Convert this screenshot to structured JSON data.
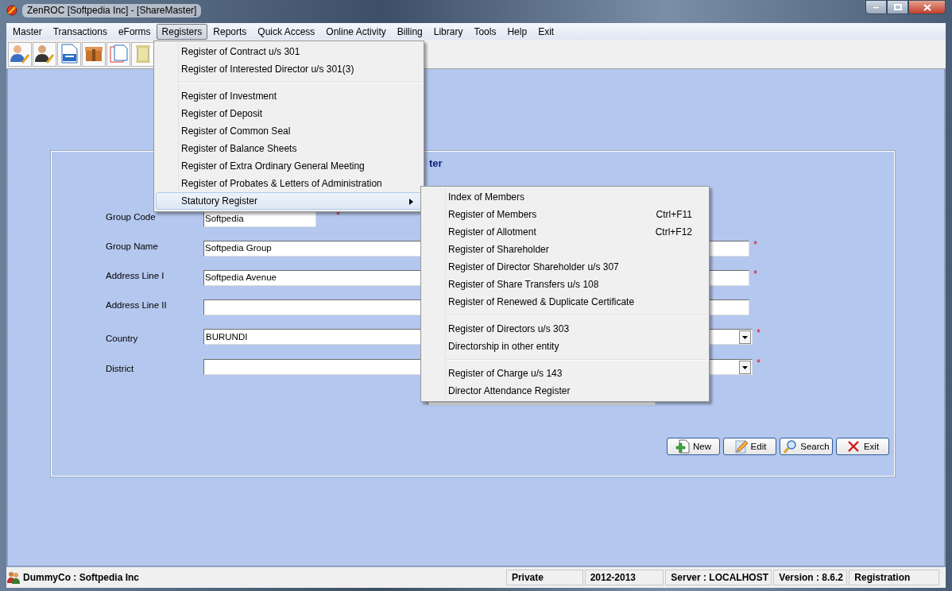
{
  "window": {
    "title": "ZenROC [Softpedia Inc] - [ShareMaster]"
  },
  "menu_bar": [
    {
      "label": "Master",
      "selected": false
    },
    {
      "label": "Transactions",
      "selected": false
    },
    {
      "label": "eForms",
      "selected": false
    },
    {
      "label": "Registers",
      "selected": true
    },
    {
      "label": "Reports",
      "selected": false
    },
    {
      "label": "Quick Access",
      "selected": false
    },
    {
      "label": "Online Activity",
      "selected": false
    },
    {
      "label": "Billing",
      "selected": false
    },
    {
      "label": "Library",
      "selected": false
    },
    {
      "label": "Tools",
      "selected": false
    },
    {
      "label": "Help",
      "selected": false
    },
    {
      "label": "Exit",
      "selected": false
    }
  ],
  "toolbar": [
    {
      "kind": "user-edit"
    },
    {
      "kind": "user-dark"
    },
    {
      "kind": "form"
    },
    {
      "kind": "box"
    },
    {
      "kind": "pages"
    },
    {
      "kind": "scroll"
    }
  ],
  "registers_menu": [
    {
      "kind": "item",
      "label": "Register of Contract u/s 301",
      "selected": false
    },
    {
      "kind": "item",
      "label": "Register of Interested Director u/s 301(3)",
      "selected": false
    },
    {
      "kind": "separator"
    },
    {
      "kind": "item",
      "label": "Register of Investment",
      "selected": false
    },
    {
      "kind": "item",
      "label": "Register of Deposit",
      "selected": false
    },
    {
      "kind": "item",
      "label": "Register of Common Seal",
      "selected": false
    },
    {
      "kind": "item",
      "label": "Register of Balance Sheets",
      "selected": false
    },
    {
      "kind": "item",
      "label": "Register of Extra Ordinary General Meeting",
      "selected": false
    },
    {
      "kind": "item",
      "label": "Register of Probates & Letters of Administration",
      "selected": false
    },
    {
      "kind": "submenu",
      "label": "Statutory Register",
      "selected": true
    }
  ],
  "statutory_submenu": [
    {
      "kind": "item",
      "label": "Index of Members",
      "selected": false
    },
    {
      "kind": "item",
      "label": "Register of Members",
      "shortcut": "Ctrl+F11",
      "selected": false
    },
    {
      "kind": "item",
      "label": "Register of Allotment",
      "shortcut": "Ctrl+F12",
      "selected": false
    },
    {
      "kind": "item",
      "label": "Register of Shareholder",
      "selected": false
    },
    {
      "kind": "item",
      "label": "Register of Director Shareholder u/s 307",
      "selected": false
    },
    {
      "kind": "item",
      "label": "Register of Share Transfers u/s 108",
      "selected": false
    },
    {
      "kind": "item",
      "label": "Register of Renewed & Duplicate Certificate",
      "selected": false
    },
    {
      "kind": "separator"
    },
    {
      "kind": "item",
      "label": "Register of Directors u/s 303",
      "selected": false
    },
    {
      "kind": "item",
      "label": "Directorship in other entity",
      "selected": false
    },
    {
      "kind": "separator"
    },
    {
      "kind": "item",
      "label": "Register of Charge u/s 143",
      "selected": false
    },
    {
      "kind": "item",
      "label": "Director Attendance Register",
      "selected": false
    }
  ],
  "form": {
    "title": "ter",
    "fields": [
      {
        "kind": "short-text",
        "label": "Group Code",
        "value": "Softpedia",
        "marker": "*"
      },
      {
        "kind": "text",
        "label": "Group Name",
        "value": "Softpedia Group",
        "marker": "*"
      },
      {
        "kind": "text",
        "label": "Address Line I",
        "value": "Softpedia Avenue",
        "marker": "*"
      },
      {
        "kind": "text",
        "label": "Address Line II"
      },
      {
        "kind": "dropdown",
        "label": "Country",
        "value": "BURUNDI",
        "marker": "*"
      },
      {
        "kind": "dropdown",
        "label": "District",
        "marker": "*"
      },
      {
        "kind": "right-text"
      }
    ],
    "buttons": [
      {
        "kind": "new",
        "label": "New"
      },
      {
        "kind": "edit",
        "label": "Edit"
      },
      {
        "kind": "search",
        "label": "Search"
      },
      {
        "kind": "exit",
        "label": "Exit"
      }
    ]
  },
  "status_bar": [
    {
      "kind": "company",
      "text": "DummyCo : Softpedia Inc"
    },
    {
      "kind": "cell",
      "text": "Private"
    },
    {
      "kind": "cell",
      "text": "2012-2013"
    },
    {
      "kind": "cell",
      "text": "Server : LOCALHOST"
    },
    {
      "kind": "cell",
      "text": "Version : 8.6.2"
    },
    {
      "kind": "cell",
      "text": "Registration"
    }
  ]
}
